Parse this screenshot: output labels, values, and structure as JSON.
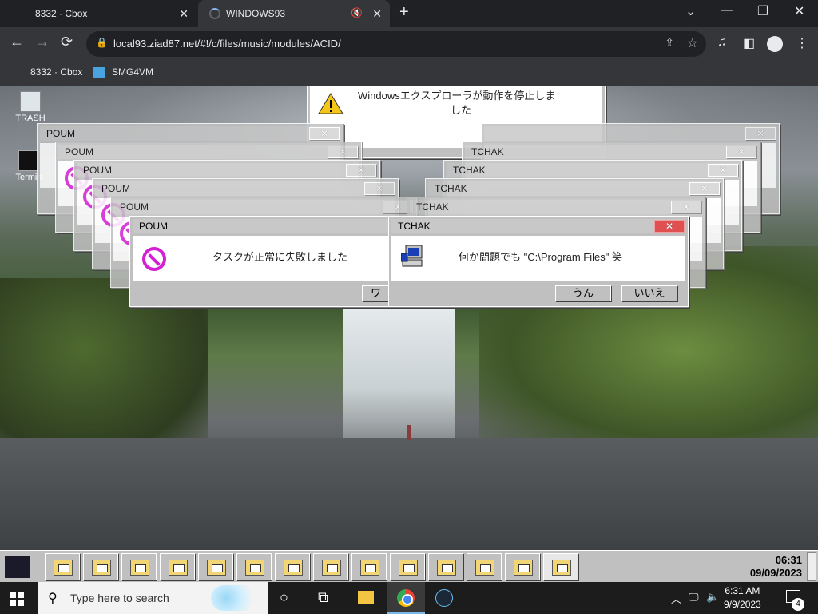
{
  "browser": {
    "tabs": [
      {
        "title": "8332 · Cbox",
        "close": "✕"
      },
      {
        "title": "WINDOWS93",
        "close": "✕",
        "mute": "🔇"
      }
    ],
    "new_tab": "+",
    "window_controls": {
      "dropdown": "⌄",
      "minimize": "—",
      "restore": "❐",
      "close": "✕"
    },
    "nav": {
      "back": "←",
      "forward": "→",
      "reload": "⟳"
    },
    "url": "local93.ziad87.net/#!/c/files/music/modules/ACID/",
    "bookmarks": [
      {
        "label": "8332 · Cbox"
      },
      {
        "label": "SMG4VM"
      }
    ]
  },
  "desktop": {
    "icons": [
      {
        "label": "TRASH",
        "icon": "recycle-bin-icon"
      },
      {
        "label": "Termin",
        "icon": "terminal-icon"
      }
    ],
    "top_dialog": {
      "message_line1": "Windowsエクスプローラが動作を停止しま",
      "message_line2": "した"
    },
    "poum_dialog": {
      "title": "POUM",
      "close": "✕",
      "message": "タスクが正常に失敗しました",
      "button_partial": "ワ"
    },
    "tchak_dialog": {
      "title": "TCHAK",
      "close": "✕",
      "message": "何か問題でも \"C:\\Program Files\" 笑",
      "yes_label": "うん",
      "no_label": "いいえ"
    },
    "colors": {
      "accent_close": "#e05050",
      "no_entry": "#d41fd4"
    }
  },
  "taskbar93": {
    "buttons": 14,
    "clock_time": "06:31",
    "clock_date": "09/09/2023"
  },
  "windows_taskbar": {
    "search_placeholder": "Type here to search",
    "time": "6:31 AM",
    "date": "9/9/2023",
    "notification_count": "4"
  }
}
